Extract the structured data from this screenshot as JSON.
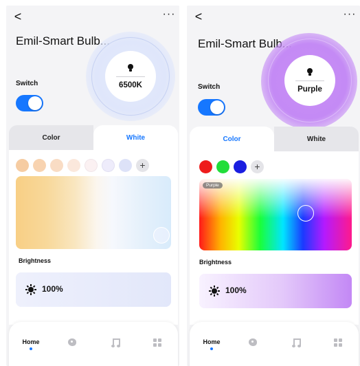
{
  "screens": [
    {
      "id": "white",
      "header": {
        "back_icon": "chevron-left-icon",
        "back_glyph": "<",
        "more_icon": "more-dots-icon",
        "more_glyph": "···"
      },
      "device_name": "Emil-Smart Bulb...",
      "bulb": {
        "icon": "lightbulb-icon",
        "label": "6500K",
        "halo_color": "#dfe6fb"
      },
      "switch": {
        "label": "Switch",
        "on": true
      },
      "tabs": [
        {
          "label": "Color",
          "active": false
        },
        {
          "label": "White",
          "active": true
        }
      ],
      "swatches": [
        "#f6cca2",
        "#f8d3b0",
        "#f9dcc4",
        "#fbe8dc",
        "#fbf1f2",
        "#eeecfb",
        "#dde2f8"
      ],
      "add_label": "+",
      "brightness": {
        "label": "Brightness",
        "value": "100%",
        "percent": 100
      }
    },
    {
      "id": "color",
      "header": {
        "back_icon": "chevron-left-icon",
        "back_glyph": "<",
        "more_icon": "more-dots-icon",
        "more_glyph": "···"
      },
      "device_name": "Emil-Smart Bulb...",
      "bulb": {
        "icon": "lightbulb-icon",
        "label": "Purple",
        "halo_color": "#c690f5"
      },
      "switch": {
        "label": "Switch",
        "on": true
      },
      "tabs": [
        {
          "label": "Color",
          "active": true
        },
        {
          "label": "White",
          "active": false
        }
      ],
      "swatches": [
        "#ee1c1c",
        "#22dd3a",
        "#1a1ee0"
      ],
      "add_label": "+",
      "picker_tag": "Purple",
      "brightness": {
        "label": "Brightness",
        "value": "100%",
        "percent": 100
      }
    }
  ],
  "bottom_nav": {
    "items": [
      {
        "label": "Home",
        "icon": "home-tab",
        "active": true
      },
      {
        "label": "",
        "icon": "palette-icon",
        "active": false
      },
      {
        "label": "",
        "icon": "music-icon",
        "active": false
      },
      {
        "label": "",
        "icon": "grid-icon",
        "active": false
      }
    ]
  },
  "accent_color": "#1677ff"
}
